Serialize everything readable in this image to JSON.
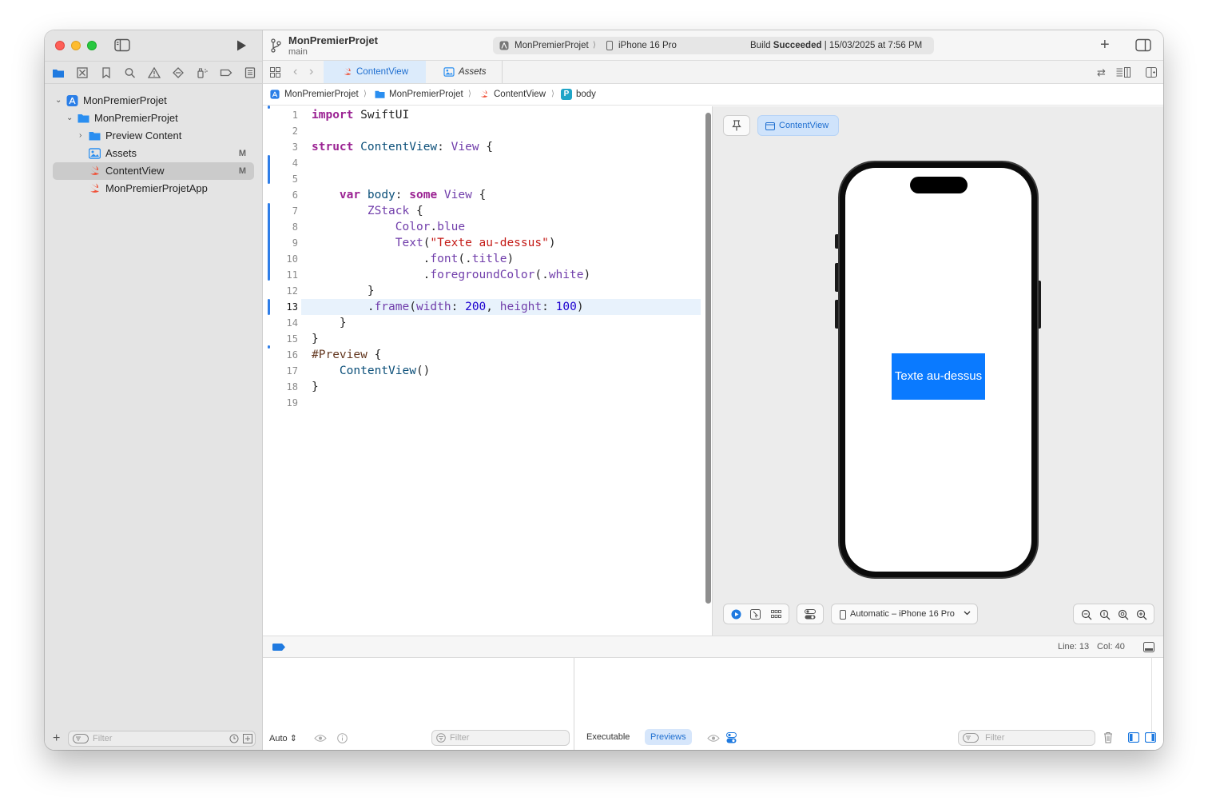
{
  "sidebar": {
    "tree": [
      {
        "label": "MonPremierProjet",
        "badge": ""
      },
      {
        "label": "MonPremierProjet",
        "badge": ""
      },
      {
        "label": "Preview Content",
        "badge": ""
      },
      {
        "label": "Assets",
        "badge": "M"
      },
      {
        "label": "ContentView",
        "badge": "M"
      },
      {
        "label": "MonPremierProjetApp",
        "badge": ""
      }
    ],
    "filter_placeholder": "Filter"
  },
  "toolbar": {
    "project_name": "MonPremierProjet",
    "branch": "main",
    "scheme": "MonPremierProjet",
    "device": "iPhone 16 Pro",
    "build_status_prefix": "Build ",
    "build_status": "Succeeded",
    "build_time": " | 15/03/2025 at 7:56 PM",
    "add_label": "+"
  },
  "tabs": [
    {
      "label": "ContentView",
      "active": true
    },
    {
      "label": "Assets",
      "active": false
    }
  ],
  "breadcrumb": [
    "MonPremierProjet",
    "MonPremierProjet",
    "ContentView",
    "body"
  ],
  "breadcrumb_symbol": "P",
  "code": {
    "line_numbers": [
      "1",
      "2",
      "3",
      "4",
      "5",
      "6",
      "7",
      "8",
      "9",
      "10",
      "11",
      "12",
      "13",
      "14",
      "15",
      "16",
      "17",
      "18",
      "19"
    ],
    "current_line": "13"
  },
  "preview": {
    "target_label": "ContentView",
    "device_selector": "Automatic – iPhone 16 Pro",
    "phone_text": "Texte au-dessus",
    "box_color": "#0a7aff"
  },
  "status": {
    "line_label": "Line: 13",
    "col_label": "Col: 40"
  },
  "debug": {
    "auto_label": "Auto",
    "filter_placeholder": "Filter",
    "executable_label": "Executable",
    "previews_label": "Previews"
  }
}
